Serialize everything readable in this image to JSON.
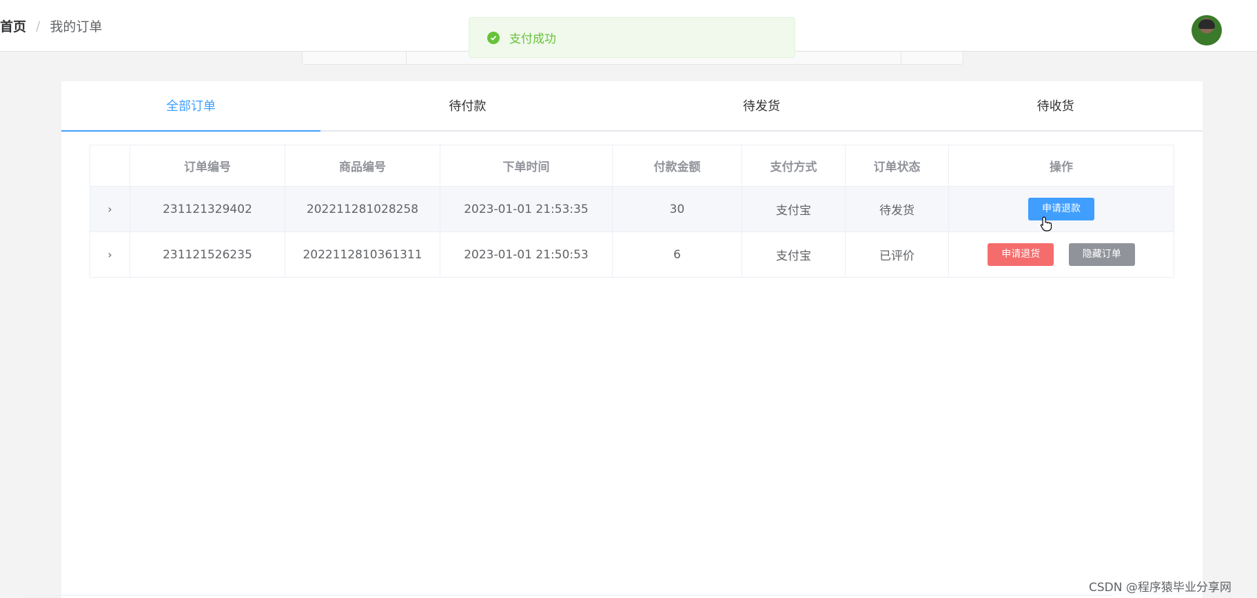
{
  "breadcrumb": {
    "home": "首页",
    "separator": "/",
    "current": "我的订单"
  },
  "toast": {
    "message": "支付成功",
    "icon": "check-circle-icon",
    "color": "#67c23a"
  },
  "tabs": [
    {
      "label": "全部订单",
      "active": true
    },
    {
      "label": "待付款",
      "active": false
    },
    {
      "label": "待发货",
      "active": false
    },
    {
      "label": "待收货",
      "active": false
    }
  ],
  "table": {
    "columns": [
      "订单编号",
      "商品编号",
      "下单时间",
      "付款金额",
      "支付方式",
      "订单状态",
      "操作"
    ],
    "rows": [
      {
        "order_no": "231121329402",
        "product_no": "202211281028258",
        "time": "2023-01-01 21:53:35",
        "amount": "30",
        "pay_method": "支付宝",
        "status": "待发货",
        "actions": [
          "申请退款"
        ]
      },
      {
        "order_no": "231121526235",
        "product_no": "2022112810361311",
        "time": "2023-01-01 21:50:53",
        "amount": "6",
        "pay_method": "支付宝",
        "status": "已评价",
        "actions": [
          "申请退货",
          "隐藏订单"
        ]
      }
    ]
  },
  "colors": {
    "accent": "#409eff",
    "danger": "#f56c6c",
    "info": "#909399",
    "success": "#67c23a"
  },
  "watermark": "CSDN @程序猿毕业分享网"
}
